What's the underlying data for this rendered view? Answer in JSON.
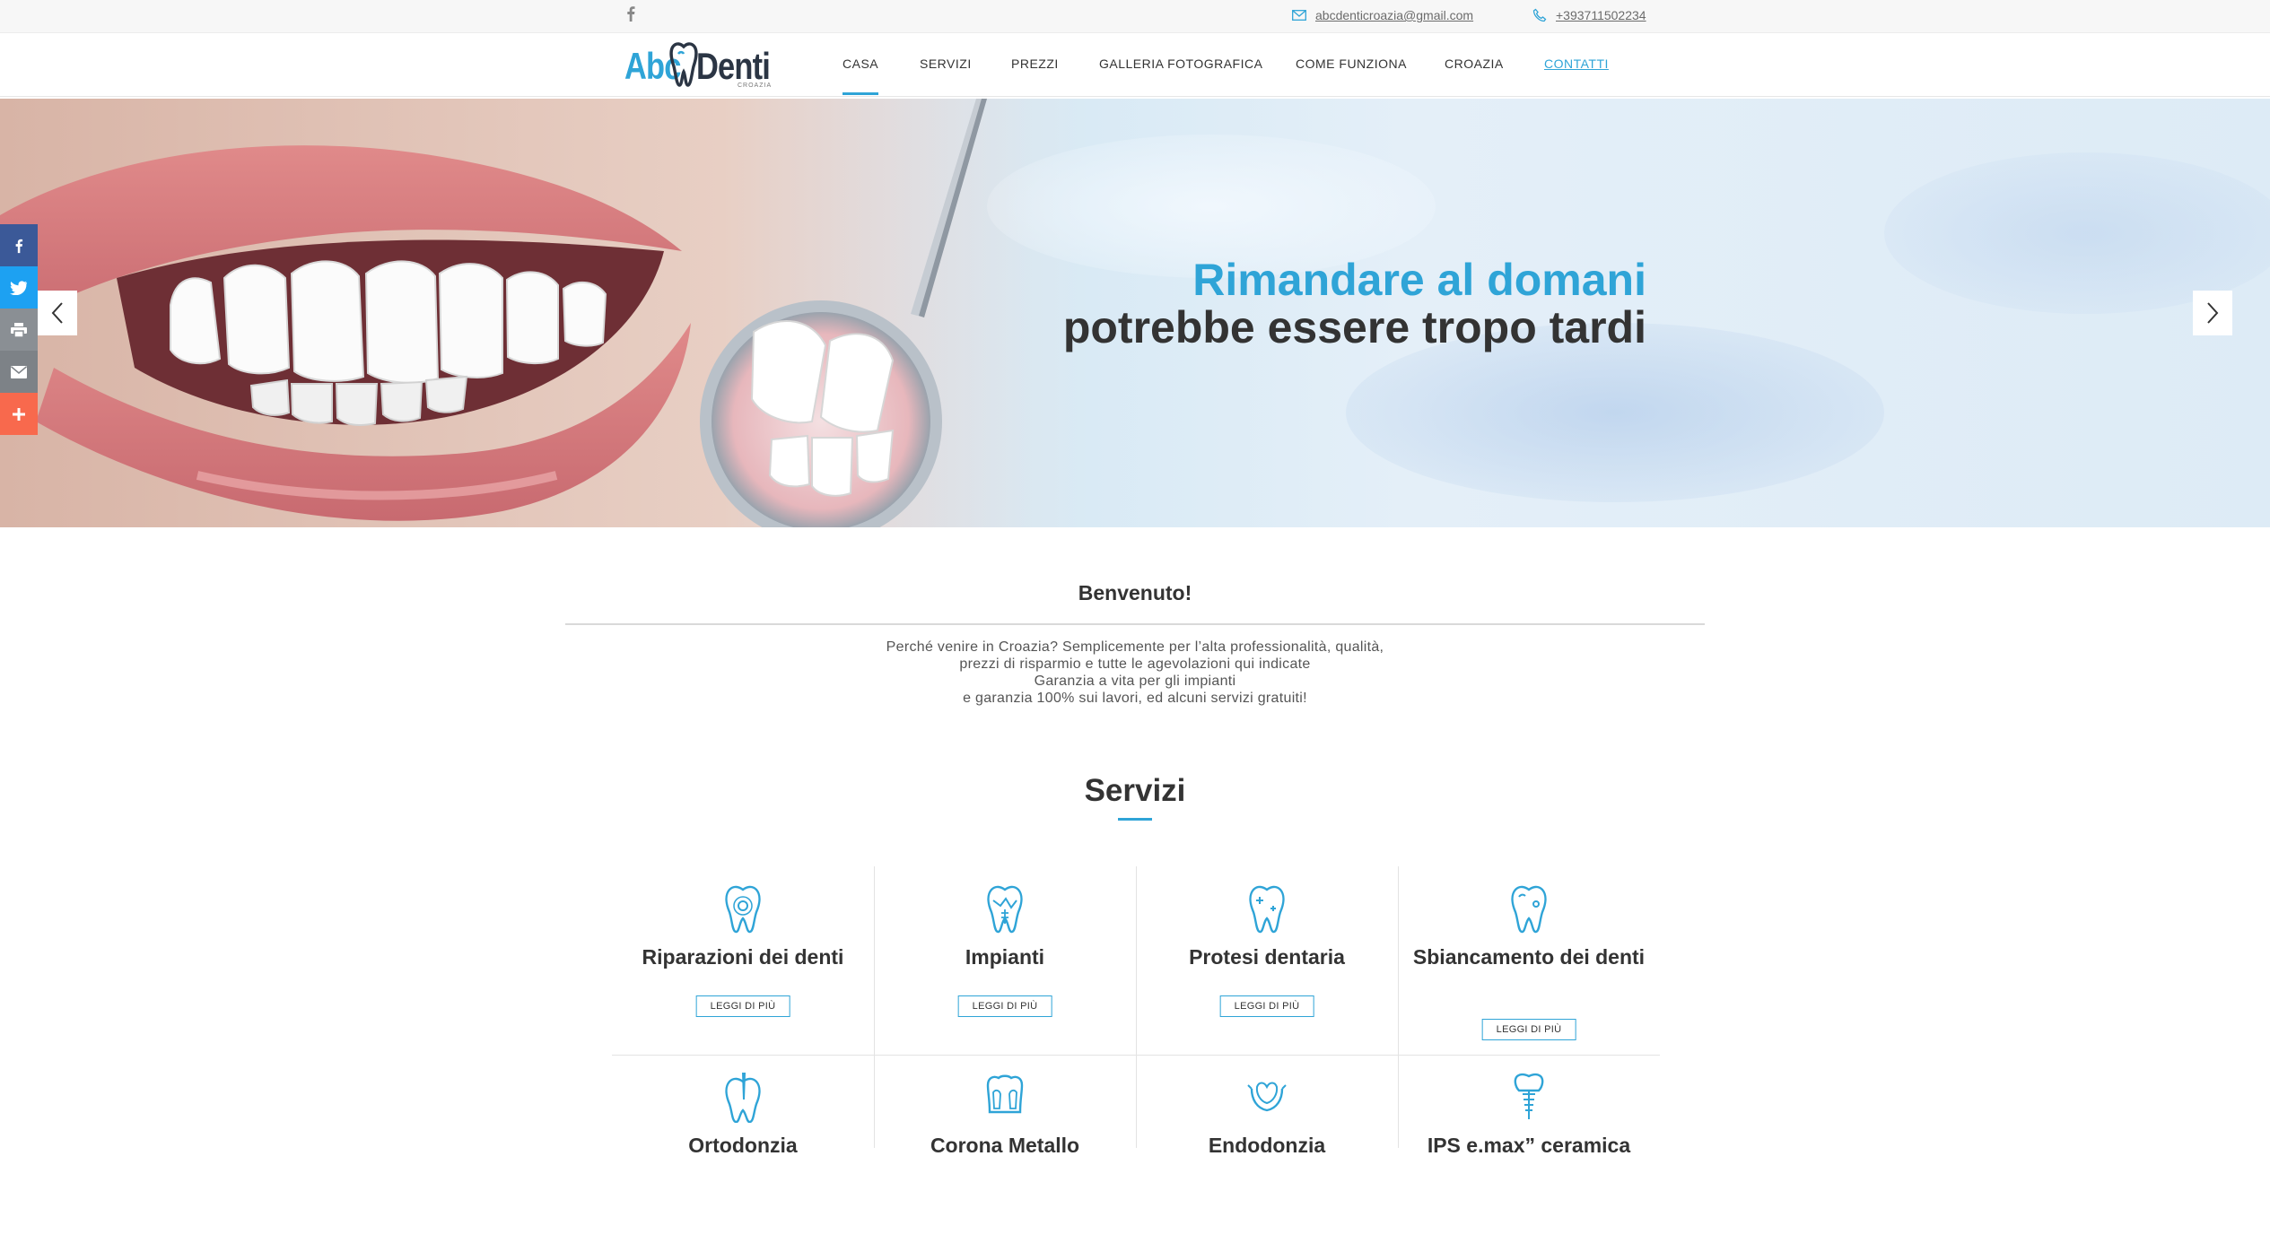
{
  "topbar": {
    "email": "abcdenticroazia@gmail.com",
    "phone": "+393711502234"
  },
  "logo": {
    "part1": "Abc",
    "part2": "Denti",
    "sub": "CROAZIA"
  },
  "nav": [
    {
      "label": "CASA",
      "active": true
    },
    {
      "label": "SERVIZI"
    },
    {
      "label": "PREZZI"
    },
    {
      "label": "GALLERIA FOTOGRAFICA"
    },
    {
      "label": "COME FUNZIONA"
    },
    {
      "label": "CROAZIA"
    },
    {
      "label": "CONTATTI",
      "link": true
    }
  ],
  "hero": {
    "line1": "Rimandare al domani",
    "line2": "potrebbe essere tropo tardi"
  },
  "social": [
    "facebook-icon",
    "twitter-icon",
    "print-icon",
    "email-icon",
    "plus-icon"
  ],
  "welcome": {
    "title": "Benvenuto!",
    "line1": "Perché venire in Croazia? Semplicemente per l’alta professionalità, qualità,",
    "line2": "prezzi di risparmio e tutte le agevolazioni qui indicate",
    "line3": "Garanzia a vita per gli impianti",
    "line4": "e garanzia 100% sui lavori, ed alcuni servizi gratuiti!"
  },
  "services": {
    "title": "Servizi",
    "button_label": "LEGGI DI PIÙ",
    "items": [
      {
        "title": "Riparazioni dei denti"
      },
      {
        "title": "Impianti"
      },
      {
        "title": "Protesi dentaria"
      },
      {
        "title": "Sbiancamento dei denti"
      },
      {
        "title": "Ortodonzia"
      },
      {
        "title": "Corona Metallo"
      },
      {
        "title": "Endodonzia"
      },
      {
        "title": "IPS e.max” ceramica"
      }
    ]
  },
  "colors": {
    "accent": "#2fa4d7",
    "dark": "#333333"
  }
}
